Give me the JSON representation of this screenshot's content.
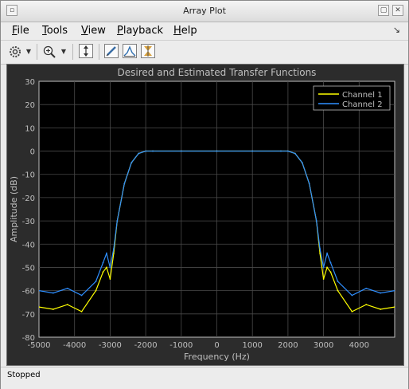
{
  "window": {
    "title": "Array Plot"
  },
  "menubar": {
    "items": [
      {
        "label": "File",
        "underline": "F",
        "rest": "ile"
      },
      {
        "label": "Tools",
        "underline": "T",
        "rest": "ools"
      },
      {
        "label": "View",
        "underline": "V",
        "rest": "iew"
      },
      {
        "label": "Playback",
        "underline": "P",
        "rest": "layback"
      },
      {
        "label": "Help",
        "underline": "H",
        "rest": "elp"
      }
    ],
    "dock_icon": "dock-arrow-icon"
  },
  "toolbar": {
    "icons": [
      "gear-icon",
      "zoom-in-icon",
      "scale-axes-icon",
      "edit-icon",
      "peak-finder-icon",
      "cursor-measure-icon"
    ]
  },
  "chart_data": {
    "type": "line",
    "title": "Desired and Estimated Transfer Functions",
    "xlabel": "Frequency (Hz)",
    "ylabel": "Amplitude (dB)",
    "xlim": [
      -5000,
      5000
    ],
    "ylim": [
      -80,
      30
    ],
    "xticks": [
      -5000,
      -4000,
      -3000,
      -2000,
      -1000,
      0,
      1000,
      2000,
      3000,
      4000
    ],
    "yticks": [
      30,
      20,
      10,
      0,
      -10,
      -20,
      -30,
      -40,
      -50,
      -60,
      -70,
      -80
    ],
    "grid": true,
    "legend_position": "top-right",
    "colors": {
      "background": "#000000",
      "axes": "#bfbfbf",
      "grid": "#4a4a4a",
      "text": "#bfbfbf"
    },
    "series": [
      {
        "name": "Channel 1",
        "color": "#ffff00",
        "x": [
          -5000,
          -4600,
          -4200,
          -3800,
          -3400,
          -3200,
          -3100,
          -3000,
          -2900,
          -2800,
          -2600,
          -2400,
          -2200,
          -2000,
          -1800,
          -1000,
          0,
          1000,
          1800,
          2000,
          2200,
          2400,
          2600,
          2800,
          2900,
          3000,
          3100,
          3200,
          3400,
          3800,
          4200,
          4600,
          5000
        ],
        "y": [
          -67,
          -68,
          -66,
          -69,
          -60,
          -52,
          -50,
          -55,
          -44,
          -30,
          -14,
          -5,
          -1,
          0,
          0,
          0,
          0,
          0,
          0,
          0,
          -1,
          -5,
          -14,
          -30,
          -44,
          -55,
          -50,
          -52,
          -60,
          -69,
          -66,
          -68,
          -67
        ]
      },
      {
        "name": "Channel 2",
        "color": "#2f8fff",
        "x": [
          -5000,
          -4600,
          -4200,
          -3800,
          -3400,
          -3200,
          -3100,
          -3000,
          -2900,
          -2800,
          -2600,
          -2400,
          -2200,
          -2000,
          -1800,
          -1000,
          0,
          1000,
          1800,
          2000,
          2200,
          2400,
          2600,
          2800,
          2900,
          3000,
          3100,
          3200,
          3400,
          3800,
          4200,
          4600,
          5000
        ],
        "y": [
          -60,
          -61,
          -59,
          -62,
          -56,
          -48,
          -44,
          -50,
          -42,
          -30,
          -14,
          -5,
          -1,
          0,
          0,
          0,
          0,
          0,
          0,
          0,
          -1,
          -5,
          -14,
          -30,
          -42,
          -50,
          -44,
          -48,
          -56,
          -62,
          -59,
          -61,
          -60
        ]
      }
    ]
  },
  "status": {
    "text": "Stopped"
  }
}
